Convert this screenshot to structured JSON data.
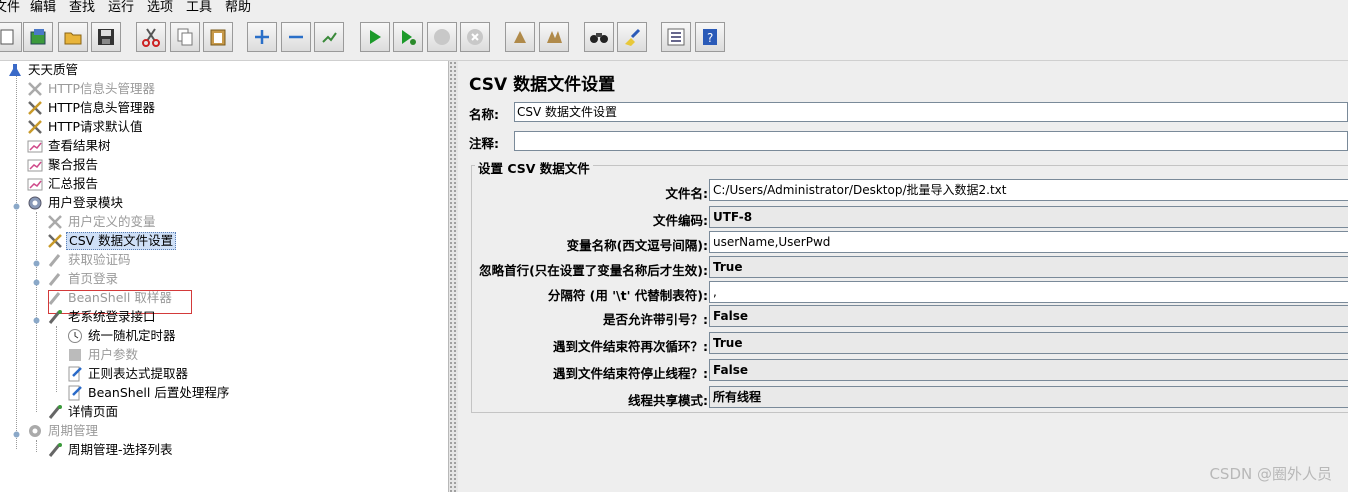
{
  "menubar": {
    "items": [
      "文件",
      "编辑",
      "查找",
      "运行",
      "选项",
      "工具",
      "帮助"
    ]
  },
  "toolbar": {
    "buttons": [
      "new-icon",
      "templates-icon",
      "open-icon",
      "save-icon",
      "cut-icon",
      "copy-icon",
      "paste-icon",
      "expand-icon",
      "collapse-icon",
      "toggle-icon",
      "start-icon",
      "start-no-pause-icon",
      "stop-icon",
      "shutdown-icon",
      "clear-icon",
      "clear-all-icon",
      "search-icon",
      "reset-search-icon",
      "function-helper-icon",
      "help-icon"
    ]
  },
  "tree": {
    "nodes": [
      {
        "label": "天天质管",
        "disabled": false,
        "icon": "test-plan-icon"
      },
      {
        "label": "HTTP信息头管理器",
        "disabled": true,
        "icon": "config-tool-icon"
      },
      {
        "label": "HTTP信息头管理器",
        "disabled": false,
        "icon": "config-tool-icon"
      },
      {
        "label": "HTTP请求默认值",
        "disabled": false,
        "icon": "config-tool-icon"
      },
      {
        "label": "查看结果树",
        "disabled": false,
        "icon": "listener-icon"
      },
      {
        "label": "聚合报告",
        "disabled": false,
        "icon": "listener-icon"
      },
      {
        "label": "汇总报告",
        "disabled": false,
        "icon": "listener-icon"
      },
      {
        "label": "用户登录模块",
        "disabled": false,
        "icon": "thread-group-icon"
      },
      {
        "label": "用户定义的变量",
        "disabled": true,
        "icon": "config-tool-icon"
      },
      {
        "label": "CSV 数据文件设置",
        "disabled": false,
        "icon": "config-tool-icon",
        "selected": true
      },
      {
        "label": "获取验证码",
        "disabled": true,
        "icon": "sampler-icon"
      },
      {
        "label": "首页登录",
        "disabled": true,
        "icon": "sampler-icon"
      },
      {
        "label": "BeanShell 取样器",
        "disabled": true,
        "icon": "sampler-icon"
      },
      {
        "label": "老系统登录接口",
        "disabled": false,
        "icon": "sampler-icon"
      },
      {
        "label": "统一随机定时器",
        "disabled": false,
        "icon": "timer-icon"
      },
      {
        "label": "用户参数",
        "disabled": true,
        "icon": "preprocessor-icon"
      },
      {
        "label": "正则表达式提取器",
        "disabled": false,
        "icon": "postprocessor-icon"
      },
      {
        "label": "BeanShell 后置处理程序",
        "disabled": false,
        "icon": "postprocessor-icon"
      },
      {
        "label": "详情页面",
        "disabled": false,
        "icon": "sampler-icon"
      },
      {
        "label": "周期管理",
        "disabled": true,
        "icon": "thread-group-icon"
      },
      {
        "label": "周期管理-选择列表",
        "disabled": false,
        "icon": "sampler-icon"
      }
    ]
  },
  "panel": {
    "title": "CSV 数据文件设置",
    "name_label": "名称:",
    "name_value": "CSV 数据文件设置",
    "comment_label": "注释:",
    "comment_value": "",
    "group_title": "设置 CSV 数据文件",
    "rows": [
      {
        "label": "文件名:",
        "value": "C:/Users/Administrator/Desktop/批量导入数据2.txt",
        "editable": true
      },
      {
        "label": "文件编码:",
        "value": "UTF-8",
        "editable": false
      },
      {
        "label": "变量名称(西文逗号间隔):",
        "value": "userName,UserPwd",
        "editable": true
      },
      {
        "label": "忽略首行(只在设置了变量名称后才生效):",
        "value": "True",
        "editable": false
      },
      {
        "label": "分隔符 (用 '\\t' 代替制表符):",
        "value": ",",
        "editable": true
      },
      {
        "label": "是否允许带引号？:",
        "value": "False",
        "editable": false
      },
      {
        "label": "遇到文件结束符再次循环？:",
        "value": "True",
        "editable": false
      },
      {
        "label": "遇到文件结束符停止线程？:",
        "value": "False",
        "editable": false
      },
      {
        "label": "线程共享模式:",
        "value": "所有线程",
        "editable": false
      }
    ]
  },
  "watermark": "CSDN @圈外人员",
  "colors": {
    "selection_border": "#d33a3a",
    "selected_bg": "#cfe0f7",
    "disabled_text": "#9a9a9a"
  }
}
